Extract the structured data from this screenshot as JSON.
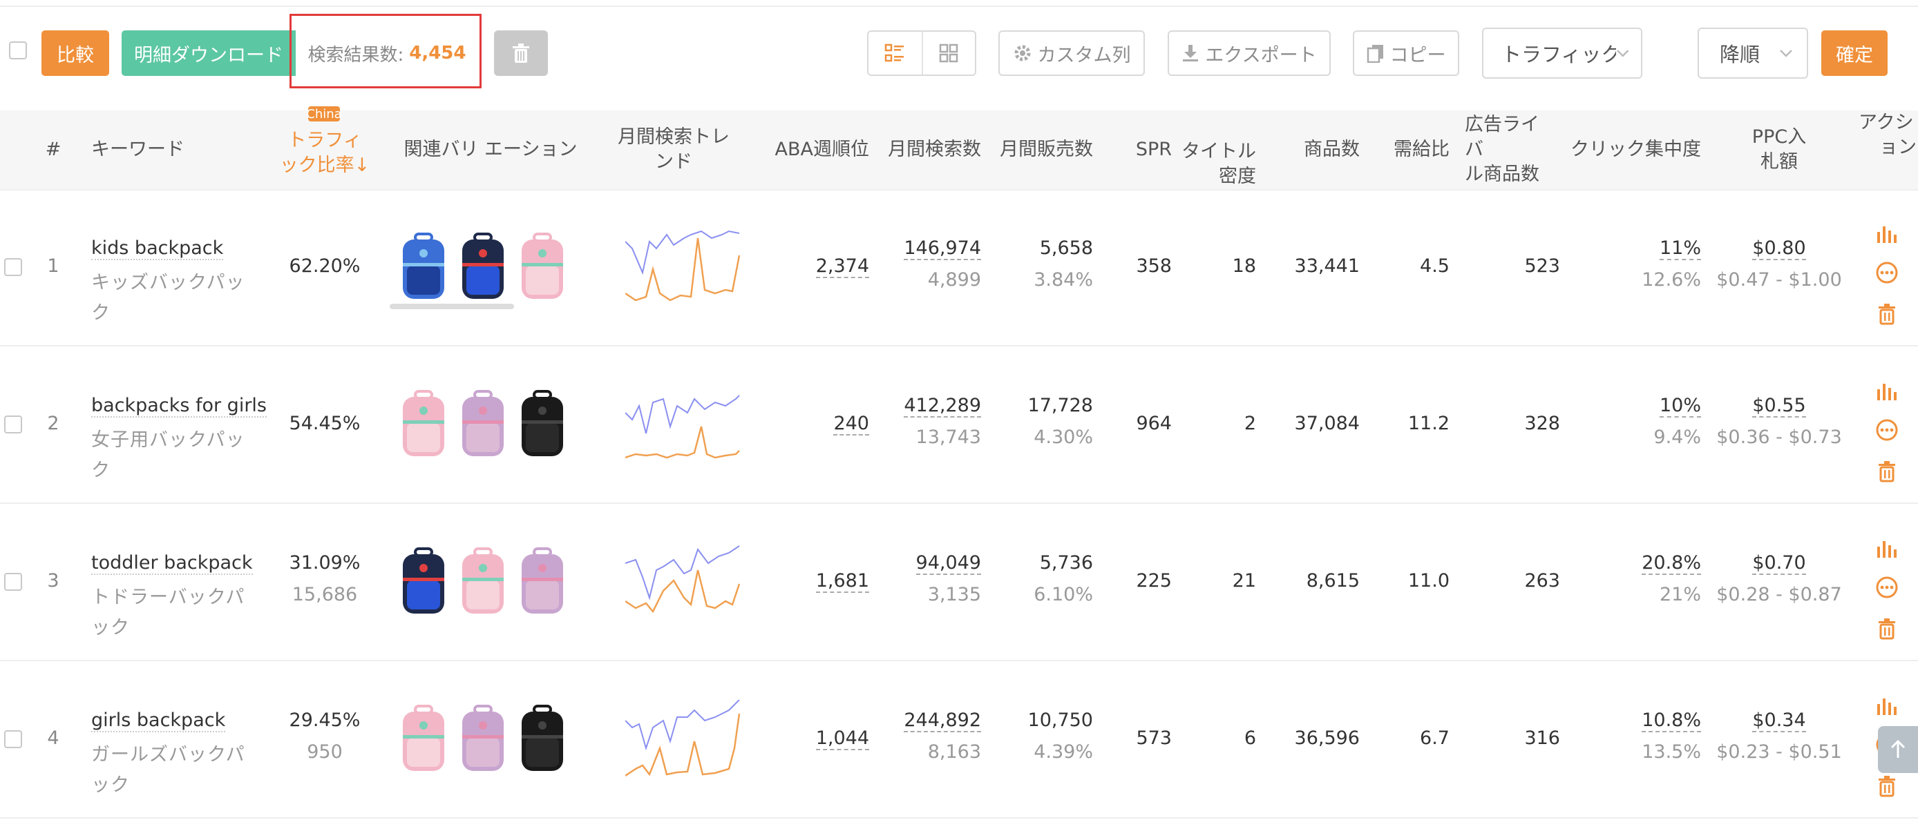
{
  "toolbar": {
    "compare_label": "比較",
    "download_label": "明細ダウンロード",
    "result_label": "検索結果数:",
    "result_count": "4,454",
    "custom_column_label": "カスタム列",
    "export_label": "エクスポート",
    "copy_label": "コピー",
    "sort_field_value": "トラフィック比",
    "sort_order_value": "降順",
    "confirm_label": "確定"
  },
  "header": {
    "index": "#",
    "keyword": "キーワード",
    "traffic_line1": "トラフィ",
    "traffic_line2": "ック比率↓",
    "traffic_tag": "China",
    "variation": "関連バリ エーション",
    "trend_line1": "月間検索トレ",
    "trend_line2": "ンド",
    "aba": "ABA週順位",
    "monthly_search": "月間検索数",
    "monthly_sales": "月間販売数",
    "spr": "SPR",
    "title_line1": "タイトル",
    "title_line2": "密度",
    "products": "商品数",
    "supply": "需給比",
    "ad_line1": "広告ライバ",
    "ad_line2": "ル商品数",
    "click": "クリック集中度",
    "ppc_line1": "PPC入",
    "ppc_line2": "札額",
    "action_line1": "アクシ",
    "action_line2": "ョン"
  },
  "rows": [
    {
      "index": "1",
      "keyword": "kids backpack",
      "keyword_ja": "キッズバックパック",
      "traffic": "62.20%",
      "traffic_sub": "",
      "aba": "2,374",
      "monthly_search": "146,974",
      "monthly_search_sub": "4,899",
      "monthly_sales": "5,658",
      "monthly_sales_sub": "3.84%",
      "spr": "358",
      "title_density": "18",
      "products": "33,441",
      "supply": "4.5",
      "ad_rivals": "523",
      "click": "11%",
      "click_sub": "12.6%",
      "ppc": "$0.80",
      "ppc_range": "$0.47 - $1.00"
    },
    {
      "index": "2",
      "keyword": "backpacks for girls",
      "keyword_ja": "女子用バックパック",
      "traffic": "54.45%",
      "traffic_sub": "",
      "aba": "240",
      "monthly_search": "412,289",
      "monthly_search_sub": "13,743",
      "monthly_sales": "17,728",
      "monthly_sales_sub": "4.30%",
      "spr": "964",
      "title_density": "2",
      "products": "37,084",
      "supply": "11.2",
      "ad_rivals": "328",
      "click": "10%",
      "click_sub": "9.4%",
      "ppc": "$0.55",
      "ppc_range": "$0.36 - $0.73"
    },
    {
      "index": "3",
      "keyword": "toddler backpack",
      "keyword_ja": "トドラーバックパック",
      "traffic": "31.09%",
      "traffic_sub": "15,686",
      "aba": "1,681",
      "monthly_search": "94,049",
      "monthly_search_sub": "3,135",
      "monthly_sales": "5,736",
      "monthly_sales_sub": "6.10%",
      "spr": "225",
      "title_density": "21",
      "products": "8,615",
      "supply": "11.0",
      "ad_rivals": "263",
      "click": "20.8%",
      "click_sub": "21%",
      "ppc": "$0.70",
      "ppc_range": "$0.28 - $0.87"
    },
    {
      "index": "4",
      "keyword": "girls backpack",
      "keyword_ja": "ガールズバックパック",
      "traffic": "29.45%",
      "traffic_sub": "950",
      "aba": "1,044",
      "monthly_search": "244,892",
      "monthly_search_sub": "8,163",
      "monthly_sales": "10,750",
      "monthly_sales_sub": "4.39%",
      "spr": "573",
      "title_density": "6",
      "products": "36,596",
      "supply": "6.7",
      "ad_rivals": "316",
      "click": "10.8%",
      "click_sub": "13.5%",
      "ppc": "$0.34",
      "ppc_range": "$0.23 - $0.51"
    }
  ],
  "colors": {
    "accent": "#f0903a",
    "green": "#5cc7a3",
    "highlight_border": "#e23a3a",
    "trend_blue": "#8a8ff0",
    "trend_orange": "#f0a050"
  }
}
